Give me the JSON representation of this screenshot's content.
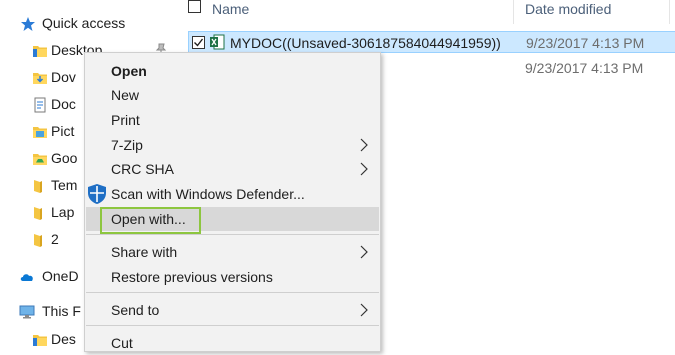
{
  "nav": {
    "quick_access": "Quick access",
    "items": [
      {
        "label": "Desktop",
        "icon": "folder-icon",
        "pinned": true
      },
      {
        "label": "Dov",
        "icon": "downloads-folder-icon"
      },
      {
        "label": "Doc",
        "icon": "documents-folder-icon"
      },
      {
        "label": "Pict",
        "icon": "pictures-folder-icon"
      },
      {
        "label": "Goo",
        "icon": "google-drive-folder-icon"
      },
      {
        "label": "Tem",
        "icon": "folder-icon"
      },
      {
        "label": "Lap",
        "icon": "folder-icon"
      },
      {
        "label": "2",
        "icon": "folder-icon"
      }
    ],
    "onedrive": "OneD",
    "this_pc": "This F",
    "this_pc_child": "Des"
  },
  "columns": {
    "name": "Name",
    "date_modified": "Date modified"
  },
  "files": [
    {
      "name": "MYDOC((Unsaved-306187584044941959))",
      "date": "9/23/2017 4:13 PM",
      "selected": true,
      "checked": true
    },
    {
      "name": "",
      "date": "9/23/2017 4:13 PM",
      "selected": false,
      "checked": false
    }
  ],
  "context_menu": {
    "items": [
      {
        "label": "Open",
        "bold": true,
        "submenu": false
      },
      {
        "label": "New",
        "submenu": false
      },
      {
        "label": "Print",
        "submenu": false
      },
      {
        "label": "7-Zip",
        "submenu": true
      },
      {
        "label": "CRC SHA",
        "submenu": true
      },
      {
        "label": "Scan with Windows Defender...",
        "submenu": false,
        "icon": "windows-defender-shield-icon"
      },
      {
        "label": "Open with...",
        "submenu": false,
        "hovered": true
      },
      {
        "label": "Share with",
        "submenu": true
      },
      {
        "label": "Restore previous versions",
        "submenu": false
      },
      {
        "label": "Send to",
        "submenu": true
      },
      {
        "label": "Cut",
        "submenu": false
      }
    ]
  },
  "colors": {
    "selection_bg": "#cce8ff",
    "selection_border": "#99d1ff",
    "menu_bg": "#f2f2f2",
    "menu_hover": "#d8d8d8",
    "highlight_box": "#8dc63f",
    "header_text": "#4c607a"
  }
}
